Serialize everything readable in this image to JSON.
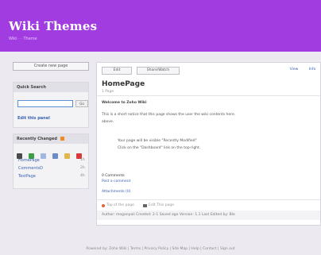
{
  "header": {
    "title": "Wiki Themes",
    "subtitle": "Wiki · · Theme"
  },
  "sidebar": {
    "create_page_label": "Create new page",
    "search": {
      "heading": "Quick Search",
      "placeholder": "",
      "go_label": "Go",
      "edit_link": "Edit this panel"
    },
    "recent": {
      "heading": "Recently Changed",
      "items": [
        {
          "label": "HomePage",
          "meta": "1h"
        },
        {
          "label": "CommentsD",
          "meta": "2h"
        },
        {
          "label": "TestPage",
          "meta": "4h"
        }
      ]
    }
  },
  "main": {
    "tabs": [
      "Edit",
      "Share/Watch",
      "View",
      "Info"
    ],
    "page_title": "HomePage",
    "page_subtitle": "1 Page",
    "welcome": "Welcome to Zoho Wiki",
    "intro": "This is a short notice that this page shows the user the wiki contents here.",
    "intro2": "above.",
    "bullet1": "Your page will be visible \"Recently Modified\"",
    "bullet2": "Click on the \"Dashboard\" link on the top-right.",
    "comments_count": "0 Comments",
    "add_comment": "Post a comment",
    "attachments": "Attachments (0)",
    "status_left": "Top of the page",
    "status_right": "Edit This page",
    "author_line": "Author: moganpali    Created: 2-1   Saved ago    Version: 1.1    Last Edited by: Ble"
  },
  "footer": {
    "text": "Powered by: Zoho Wiki | Terms | Privacy Policy | Site Map | Help | Contact | Sign out"
  }
}
